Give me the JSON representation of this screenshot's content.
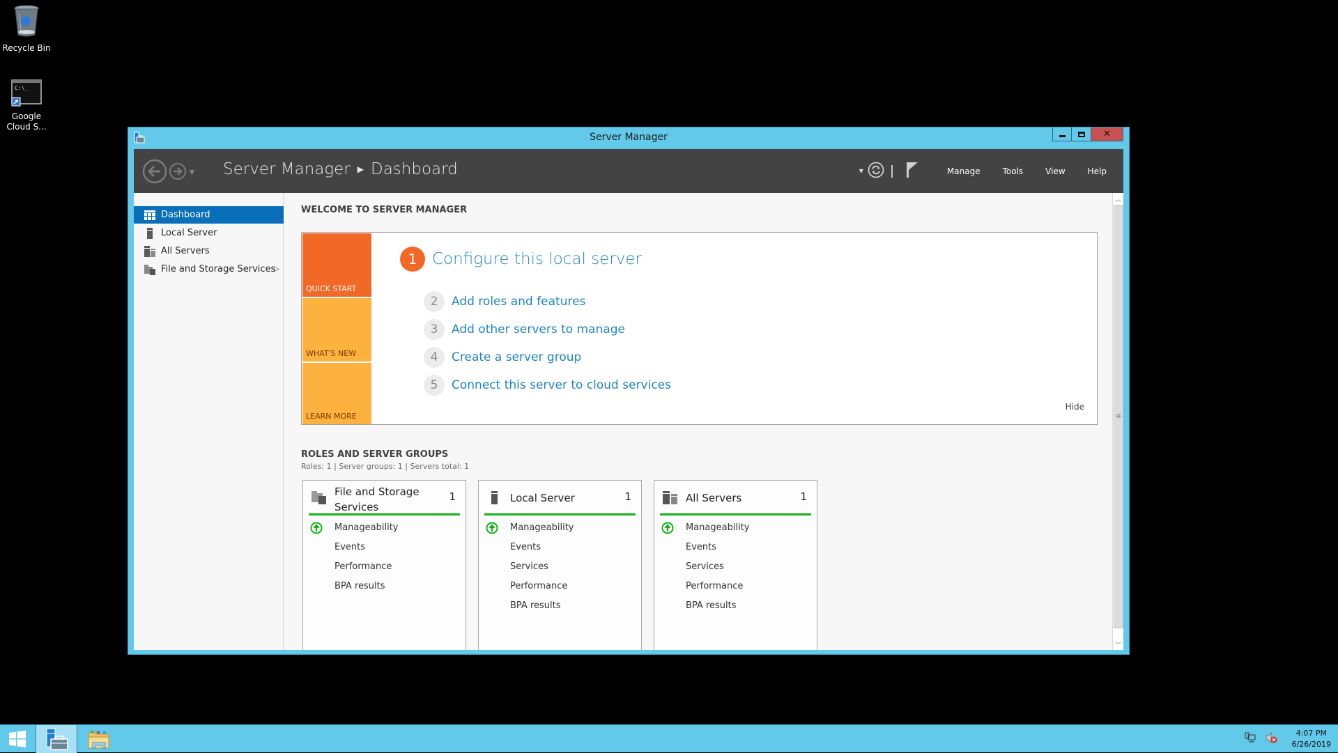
{
  "desktop": {
    "icons": [
      {
        "label": "Recycle Bin",
        "icon": "recycle-bin-icon"
      },
      {
        "label": "Google Cloud S...",
        "icon": "command-prompt-shortcut-icon"
      }
    ]
  },
  "window": {
    "title": "Server Manager",
    "controls": {
      "minimize": "minimize",
      "maximize": "maximize",
      "close": "close"
    }
  },
  "header": {
    "breadcrumb": [
      "Server Manager",
      "Dashboard"
    ],
    "menus": [
      "Manage",
      "Tools",
      "View",
      "Help"
    ]
  },
  "sidebar": {
    "items": [
      {
        "label": "Dashboard",
        "icon": "dashboard-icon",
        "active": true
      },
      {
        "label": "Local Server",
        "icon": "local-server-icon",
        "active": false
      },
      {
        "label": "All Servers",
        "icon": "all-servers-icon",
        "active": false
      },
      {
        "label": "File and Storage Services",
        "icon": "file-storage-icon",
        "active": false,
        "has_submenu": true
      }
    ]
  },
  "welcome": {
    "section_title": "WELCOME TO SERVER MANAGER",
    "tiles": [
      "QUICK START",
      "WHAT'S NEW",
      "LEARN MORE"
    ],
    "steps": [
      {
        "num": "1",
        "label": "Configure this local server"
      },
      {
        "num": "2",
        "label": "Add roles and features"
      },
      {
        "num": "3",
        "label": "Add other servers to manage"
      },
      {
        "num": "4",
        "label": "Create a server group"
      },
      {
        "num": "5",
        "label": "Connect this server to cloud services"
      }
    ],
    "hide_label": "Hide"
  },
  "roles": {
    "section_title": "ROLES AND SERVER GROUPS",
    "summary": "Roles: 1   |   Server groups: 1   |   Servers total: 1",
    "status_color": "#15b215",
    "cards": [
      {
        "title": "File and Storage Services",
        "count": "1",
        "rows": [
          "Manageability",
          "Events",
          "Performance",
          "BPA results"
        ]
      },
      {
        "title": "Local Server",
        "count": "1",
        "rows": [
          "Manageability",
          "Events",
          "Services",
          "Performance",
          "BPA results"
        ]
      },
      {
        "title": "All Servers",
        "count": "1",
        "rows": [
          "Manageability",
          "Events",
          "Services",
          "Performance",
          "BPA results"
        ]
      }
    ]
  },
  "taskbar": {
    "clock_time": "4:07 PM",
    "clock_date": "6/26/2019"
  }
}
